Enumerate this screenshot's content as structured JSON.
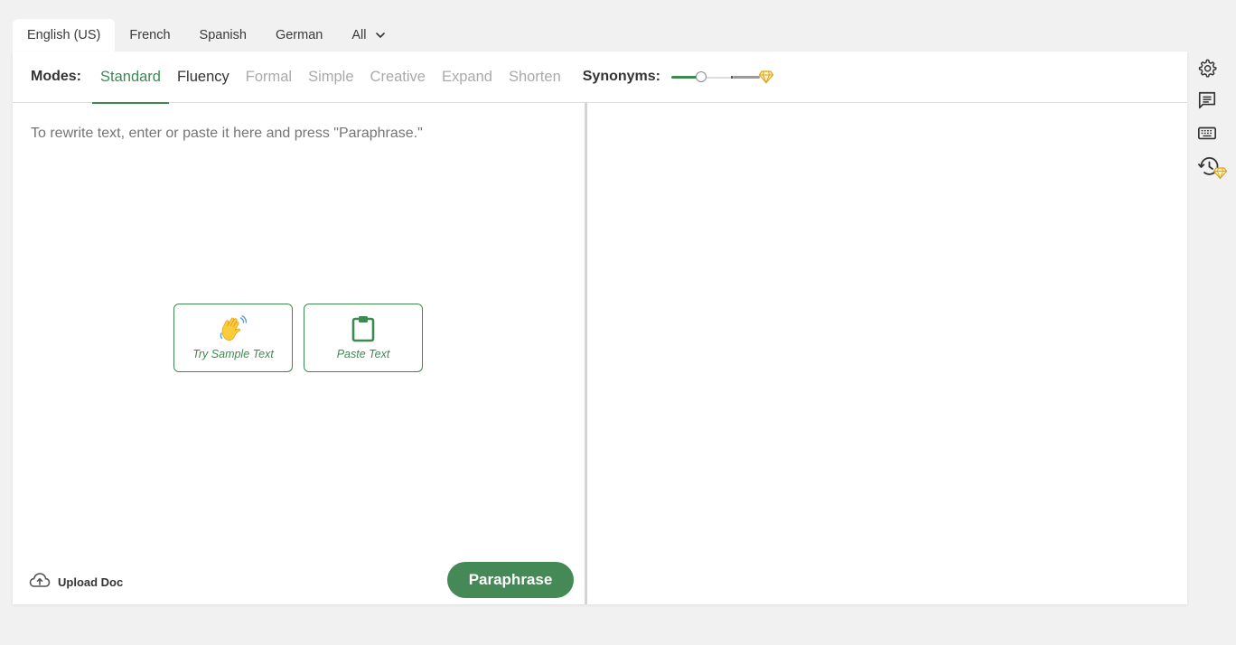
{
  "languages": {
    "tabs": [
      "English (US)",
      "French",
      "Spanish",
      "German",
      "All"
    ],
    "active": "English (US)"
  },
  "modes": {
    "label": "Modes:",
    "items": [
      "Standard",
      "Fluency",
      "Formal",
      "Simple",
      "Creative",
      "Expand",
      "Shorten"
    ],
    "active": "Standard",
    "locked": [
      "Formal",
      "Simple",
      "Creative",
      "Expand",
      "Shorten"
    ]
  },
  "synonyms": {
    "label": "Synonyms:",
    "level": 0.3
  },
  "input": {
    "placeholder": "To rewrite text, enter or paste it here and press \"Paraphrase.\""
  },
  "actions": {
    "sample": "Try Sample Text",
    "paste": "Paste Text"
  },
  "footer": {
    "upload_label": "Upload Doc",
    "paraphrase_label": "Paraphrase"
  },
  "colors": {
    "accent": "#3d8a50",
    "premium": "#f2b81f"
  },
  "sidebar": {
    "icons": [
      "settings-icon",
      "feedback-icon",
      "keyboard-icon",
      "history-icon"
    ]
  }
}
